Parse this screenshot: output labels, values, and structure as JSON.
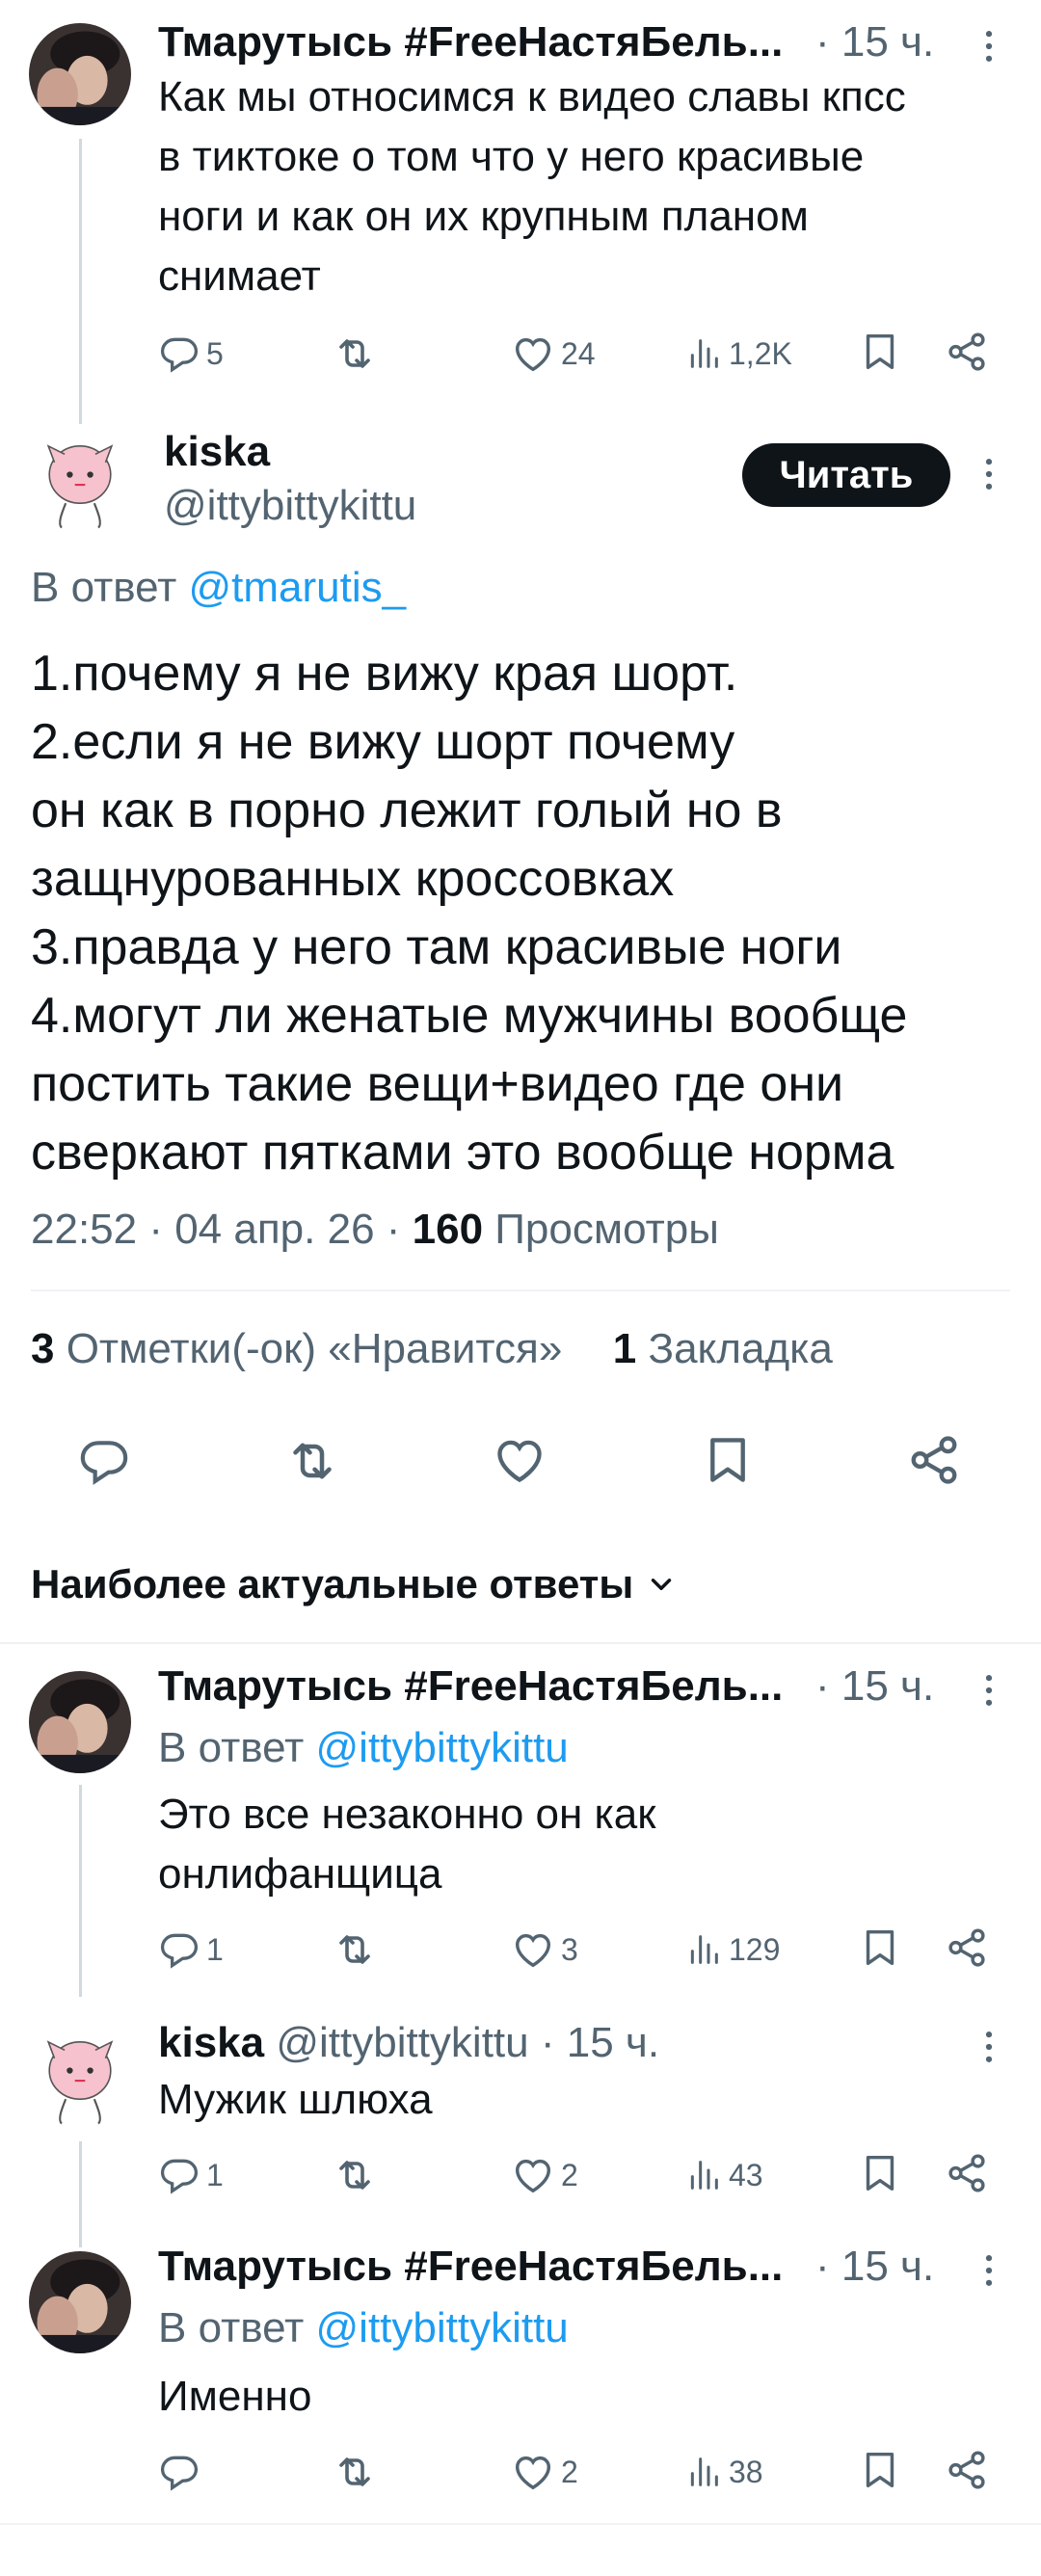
{
  "colors": {
    "link": "#1d9bf0",
    "text": "#0f1419",
    "muted": "#536471",
    "divider": "#eff3f4"
  },
  "tweet1": {
    "name": "Тмарутысь #FreeНастяБель...",
    "time": "· 15 ч.",
    "text_lines": [
      "Как мы относимся к видео славы кпсс",
      "в тиктоке о том что у него красивые",
      "ноги и как он их крупным планом",
      "снимает"
    ],
    "replies": "5",
    "likes": "24",
    "views": "1,2K"
  },
  "main": {
    "name": "kiska",
    "handle": "@ittybittykittu",
    "follow_label": "Читать",
    "reply_to_prefix": "В ответ ",
    "reply_to_handle": "@tmarutis_",
    "text_lines": [
      "1.почему я не вижу края шорт.",
      "2.если я не вижу шорт почему",
      "он как в порно лежит голый но в",
      "защнурованных кроссовках",
      "3.правда у него там красивые ноги",
      "4.могут ли женатые мужчины вообще",
      "постить такие вещи+видео где они",
      "сверкают пятками это вообще норма"
    ],
    "meta_time": "22:52 · 04 апр. 26 · ",
    "views_count": "160",
    "views_label": " Просмотры",
    "likes_count": "3",
    "likes_label": " Отметки(-ок) «Нравится»",
    "bookmarks_count": "1",
    "bookmarks_label": " Закладка"
  },
  "replies_header": "Наиболее актуальные ответы",
  "reply1": {
    "name": "Тмарутысь #FreeНастяБель...",
    "time": "· 15 ч.",
    "reply_to_prefix": "В ответ ",
    "reply_to_handle": "@ittybittykittu",
    "text_lines": [
      "Это все незаконно он как",
      "онлифанщица"
    ],
    "replies": "1",
    "likes": "3",
    "views": "129"
  },
  "reply2": {
    "name": "kiska",
    "handle": "@ittybittykittu",
    "time": "· 15 ч.",
    "text": "Мужик шлюха",
    "replies": "1",
    "likes": "2",
    "views": "43"
  },
  "reply3": {
    "name": "Тмарутысь #FreeНастяБель...",
    "time": "· 15 ч.",
    "reply_to_prefix": "В ответ ",
    "reply_to_handle": "@ittybittykittu",
    "text": "Именно",
    "likes": "2",
    "views": "38"
  }
}
